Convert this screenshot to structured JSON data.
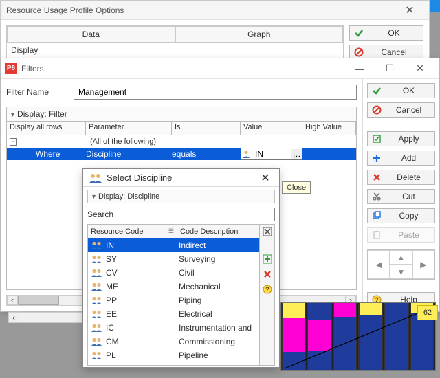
{
  "bgwin": {
    "title": "Resource Usage Profile Options",
    "tabs": {
      "data": "Data",
      "graph": "Graph"
    },
    "display_label": "Display",
    "buttons": {
      "ok": "OK",
      "cancel": "Cancel"
    }
  },
  "filters": {
    "app_badge": "P6",
    "title": "Filters",
    "filter_name_label": "Filter Name",
    "filter_name_value": "Management",
    "display_filter_label": "Display: Filter",
    "headers": {
      "display_all_rows": "Display all rows",
      "parameter": "Parameter",
      "is": "Is",
      "value": "Value",
      "high_value": "High Value"
    },
    "all_of_following": "(All of the following)",
    "row": {
      "where": "Where",
      "parameter": "Discipline",
      "is": "equals",
      "value": "IN"
    },
    "side": {
      "ok": "OK",
      "cancel": "Cancel",
      "apply": "Apply",
      "add": "Add",
      "delete": "Delete",
      "cut": "Cut",
      "copy": "Copy",
      "paste": "Paste",
      "help": "Help"
    }
  },
  "select": {
    "title": "Select Discipline",
    "close_tooltip": "Close",
    "display_label": "Display: Discipline",
    "search_label": "Search",
    "search_value": "",
    "headers": {
      "code": "Resource Code",
      "desc": "Code Description"
    },
    "rows": [
      {
        "code": "IN",
        "desc": "Indirect",
        "selected": true
      },
      {
        "code": "SY",
        "desc": "Surveying"
      },
      {
        "code": "CV",
        "desc": "Civil"
      },
      {
        "code": "ME",
        "desc": "Mechanical"
      },
      {
        "code": "PP",
        "desc": "Piping"
      },
      {
        "code": "EE",
        "desc": "Electrical"
      },
      {
        "code": "IC",
        "desc": "Instrumentation and"
      },
      {
        "code": "CM",
        "desc": "Commissioning"
      },
      {
        "code": "PL",
        "desc": "Pipeline"
      }
    ]
  },
  "yellowbox_value": "62",
  "colors": {
    "select_blue": "#0a5dd6",
    "green": "#2e9e3b",
    "red": "#d83a2b",
    "blue": "#1e6fe0",
    "magenta": "#ff00d4",
    "yellow": "#ffee58",
    "deepblue": "#1f3b9b"
  }
}
